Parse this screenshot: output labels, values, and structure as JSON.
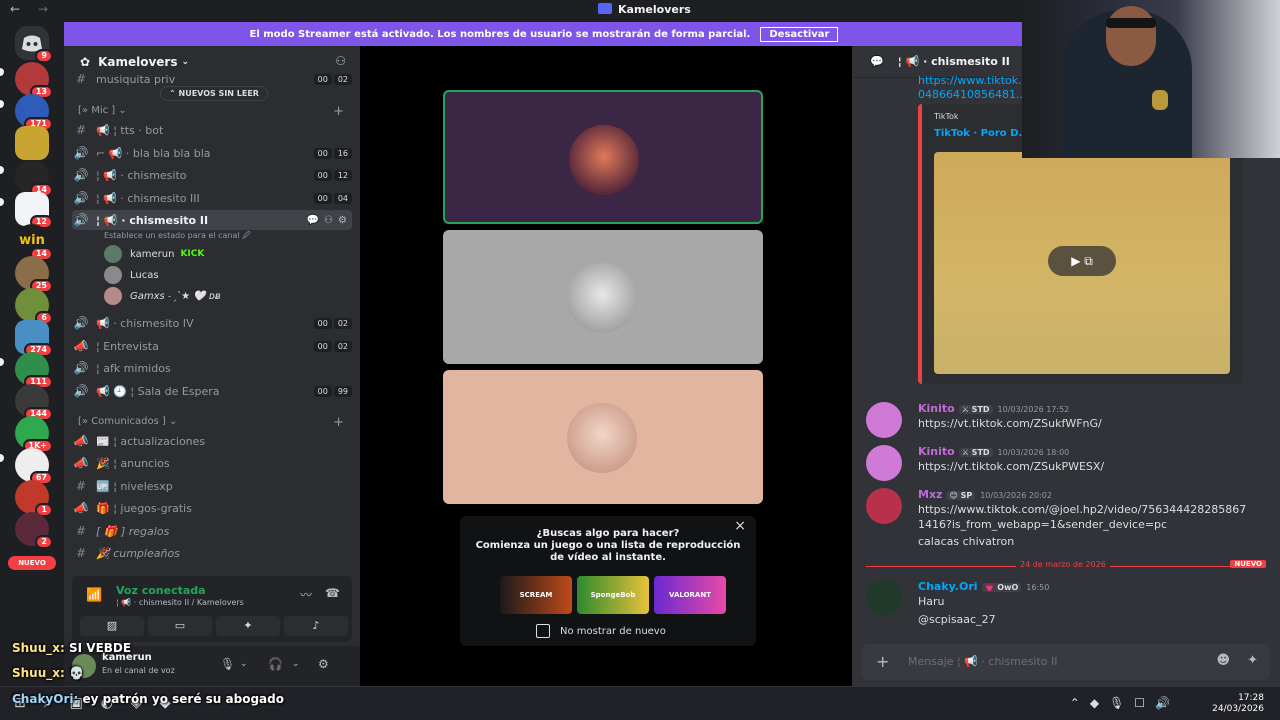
{
  "titlebar": {
    "title": "Kamelovers",
    "back": "←",
    "forward": "→"
  },
  "banner": {
    "text": "El modo Streamer está activado. Los nombres de usuario se mostrarán de forma parcial.",
    "button": "Desactivar"
  },
  "rail": {
    "badges": [
      "9",
      "13",
      "171",
      "14",
      "12",
      "14",
      "25",
      "6",
      "274",
      "111",
      "144",
      "1K+",
      "67",
      "1",
      "2"
    ],
    "new_pill": "NUEVO"
  },
  "server": {
    "name": "Kamelovers"
  },
  "sidebar": {
    "new_unread": "NUEVOS SIN LEER",
    "categories": {
      "mic": "[» Mic ] ⌄",
      "comunicados": "[» Comunicados ] ⌄"
    },
    "channels": [
      {
        "name": "musiquita priv",
        "c1": "00",
        "c2": "02"
      },
      {
        "name": "📢 ¦ tts · bot"
      },
      {
        "name": "⌐ 📢 · bla bla bla bla",
        "c1": "00",
        "c2": "16"
      },
      {
        "name": "¦ 📢 · chismesito",
        "c1": "00",
        "c2": "12"
      },
      {
        "name": "¦ 📢 · chismesito III",
        "c1": "00",
        "c2": "04"
      },
      {
        "name": "¦ 📢 · chismesito II"
      },
      {
        "name": "📢 · chismesito IV",
        "c1": "00",
        "c2": "02"
      },
      {
        "name": "¦ Entrevista",
        "c1": "00",
        "c2": "02"
      },
      {
        "name": "¦ afk mimidos"
      },
      {
        "name": "📢 🕘 ¦ Sala de Espera",
        "c1": "00",
        "c2": "99"
      },
      {
        "name": "📰 ¦ actualizaciones"
      },
      {
        "name": "🎉 ¦ anuncios"
      },
      {
        "name": "🆙 ¦ nivelesxp"
      },
      {
        "name": "🎁 ¦ juegos-gratis"
      },
      {
        "name": "[ 🎁 ] regalos"
      },
      {
        "name": "🎉 cumpleaños"
      }
    ],
    "status_hint": "Establece un estado para el canal 🖉",
    "voice_users": [
      {
        "name": "kamerun",
        "extra": "KICK"
      },
      {
        "name": "Lucas",
        "extra": ""
      },
      {
        "name": "Gamxs ˗ˏˋ★ 🤍 ᴅᴃ",
        "extra": ""
      }
    ]
  },
  "voice_panel": {
    "status": "Voz conectada",
    "channel": "¦ 📢 · chismesito II / Kamelovers"
  },
  "user_panel": {
    "name": "kamerun",
    "status": "En el canal de voz"
  },
  "stage": {
    "popup": {
      "question": "¿Buscas algo para hacer?",
      "desc": "Comienza un juego o una lista de reproducción de vídeo al instante.",
      "games": [
        "SCREAM",
        "SpongeBob",
        "VALORANT"
      ],
      "checkbox": "No mostrar de nuevo"
    }
  },
  "chat": {
    "header": "¦ 📢 · chismesito II",
    "top_link": "https://www.tiktok... 04866410856481...",
    "embed": {
      "provider": "TikTok",
      "title": "TikTok · Poro D..."
    },
    "messages": [
      {
        "author": "Kinito",
        "tag": "⚔ STD",
        "ts": "10/03/2026 17:52",
        "body": "https://vt.tiktok.com/ZSukfWFnG/",
        "color": "#c06bd8"
      },
      {
        "author": "Kinito",
        "tag": "⚔ STD",
        "ts": "10/03/2026 18:00",
        "body": "https://vt.tiktok.com/ZSukPWESX/",
        "color": "#c06bd8"
      },
      {
        "author": "Mxz",
        "tag": "😊 SP",
        "ts": "10/03/2026 20:02",
        "body": "https://www.tiktok.com/@joel.hp2/video/7563444282858671416?is_from_webapp=1&sender_device=pc",
        "body2": "calacas chivatron",
        "color": "#c06bd8"
      },
      {
        "author": "Chaky.Ori",
        "tag": "💗 OwO",
        "ts": "16:50",
        "body": "Haru",
        "body2": "@scpisaac_27",
        "color": "#00a8fc"
      }
    ],
    "divider_date": "24 de marzo de 2026",
    "divider_new": "NUEVO",
    "composer": "Mensaje ¦ 📢 · chismesito II"
  },
  "overlay": [
    {
      "name": "Shuu_x:",
      "text": " SI VEBDE"
    },
    {
      "name": "Shuu_x:",
      "text": " 💀"
    },
    {
      "name": "ChakyOri:",
      "text": " ey patrón yo seré su abogado"
    }
  ],
  "taskbar": {
    "time": "17:28",
    "date": "24/03/2026"
  }
}
